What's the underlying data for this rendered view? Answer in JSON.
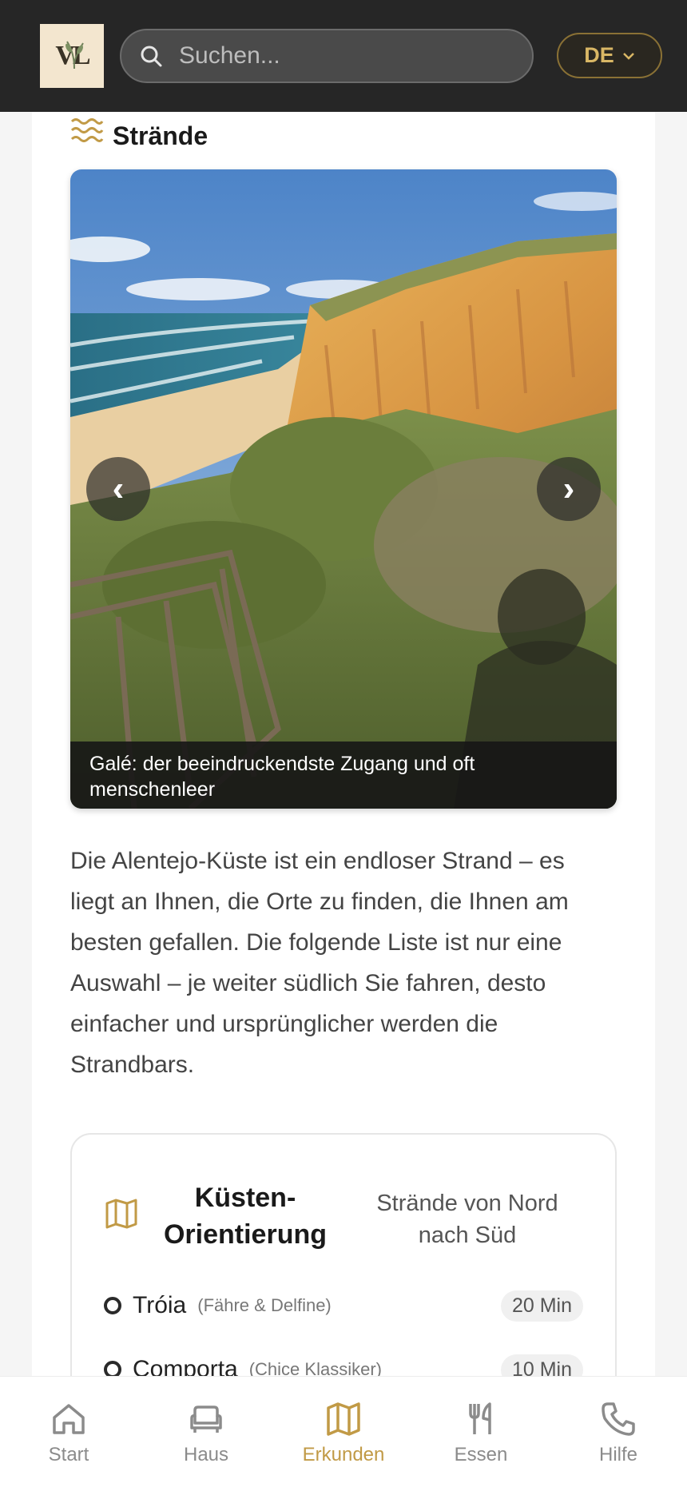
{
  "header": {
    "logo_text": "VL",
    "search_placeholder": "Suchen...",
    "language": "DE"
  },
  "section": {
    "title": "Strände",
    "icon": "waves-icon"
  },
  "carousel": {
    "caption": "Galé: der beeindruckendste Zugang und oft menschenleer",
    "prev_label": "‹",
    "next_label": "›"
  },
  "intro": "Die Alentejo-Küste ist ein endloser Strand – es liegt an Ihnen, die Orte zu finden, die Ihnen am besten gefallen. Die folgende Liste ist nur eine Auswahl – je weiter südlich Sie fahren, desto einfacher und ursprünglicher werden die Strandbars.",
  "orientation": {
    "title": "Küsten-Orientierung",
    "subtitle": "Strände von Nord nach Süd",
    "items": [
      {
        "name": "Tróia",
        "note": "(Fähre & Delfine)",
        "time": "20 Min"
      },
      {
        "name": "Comporta",
        "note": "(Chice Klassiker)",
        "time": "10 Min"
      }
    ]
  },
  "nav": {
    "items": [
      {
        "label": "Start",
        "icon": "home-icon"
      },
      {
        "label": "Haus",
        "icon": "sofa-icon"
      },
      {
        "label": "Erkunden",
        "icon": "map-icon"
      },
      {
        "label": "Essen",
        "icon": "cutlery-icon"
      },
      {
        "label": "Hilfe",
        "icon": "phone-icon"
      }
    ]
  },
  "colors": {
    "accent": "#c19a46",
    "header_bg": "#262626"
  }
}
